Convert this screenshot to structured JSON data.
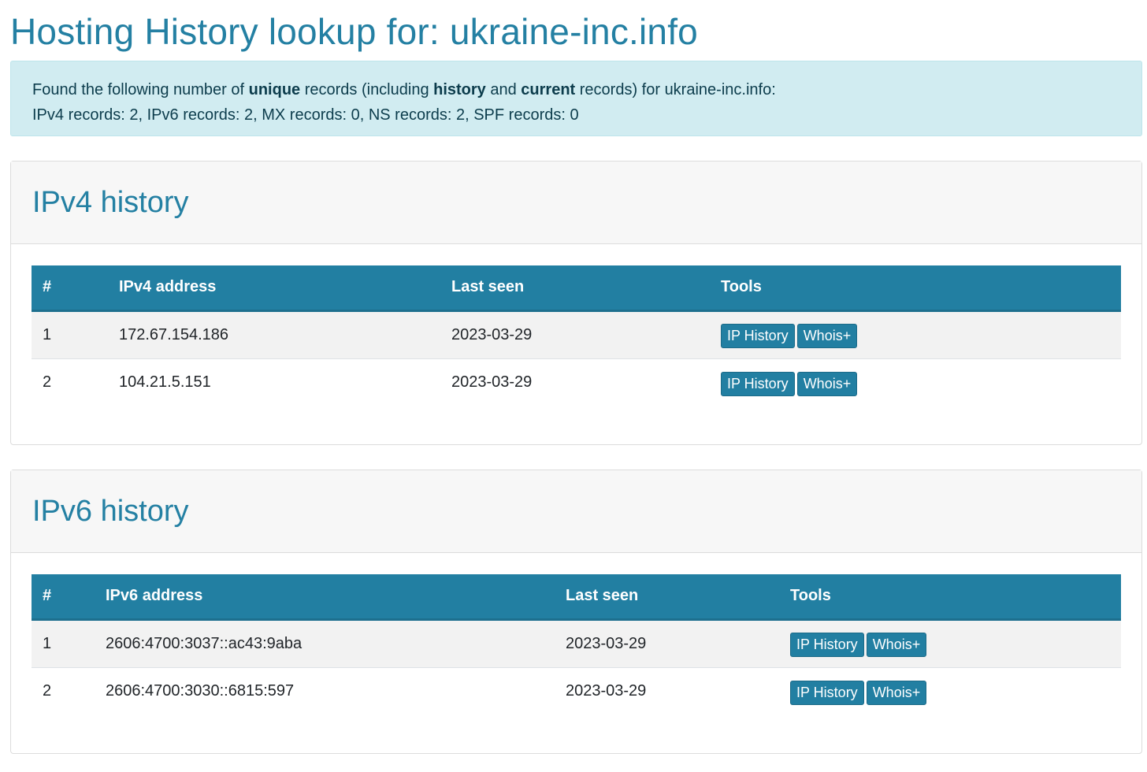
{
  "page": {
    "title": "Hosting History lookup for: ukraine-inc.info"
  },
  "summary": {
    "prefix": "Found the following number of ",
    "unique": "unique",
    "mid1": " records (including ",
    "history": "history",
    "mid2": " and ",
    "current": "current",
    "suffix": " records) for ukraine-inc.info:",
    "counts": "IPv4 records: 2, IPv6 records: 2, MX records: 0, NS records: 2, SPF records: 0"
  },
  "ipv4": {
    "heading": "IPv4 history",
    "columns": [
      "#",
      "IPv4 address",
      "Last seen",
      "Tools"
    ],
    "rows": [
      {
        "num": "1",
        "address": "172.67.154.186",
        "last_seen": "2023-03-29",
        "btn1": "IP History",
        "btn2": "Whois+"
      },
      {
        "num": "2",
        "address": "104.21.5.151",
        "last_seen": "2023-03-29",
        "btn1": "IP History",
        "btn2": "Whois+"
      }
    ]
  },
  "ipv6": {
    "heading": "IPv6 history",
    "columns": [
      "#",
      "IPv6 address",
      "Last seen",
      "Tools"
    ],
    "rows": [
      {
        "num": "1",
        "address": "2606:4700:3037::ac43:9aba",
        "last_seen": "2023-03-29",
        "btn1": "IP History",
        "btn2": "Whois+"
      },
      {
        "num": "2",
        "address": "2606:4700:3030::6815:597",
        "last_seen": "2023-03-29",
        "btn1": "IP History",
        "btn2": "Whois+"
      }
    ]
  },
  "colors": {
    "accent": "#2480a3",
    "table_header": "#227fa2",
    "alert_bg": "#d1ecf1"
  }
}
